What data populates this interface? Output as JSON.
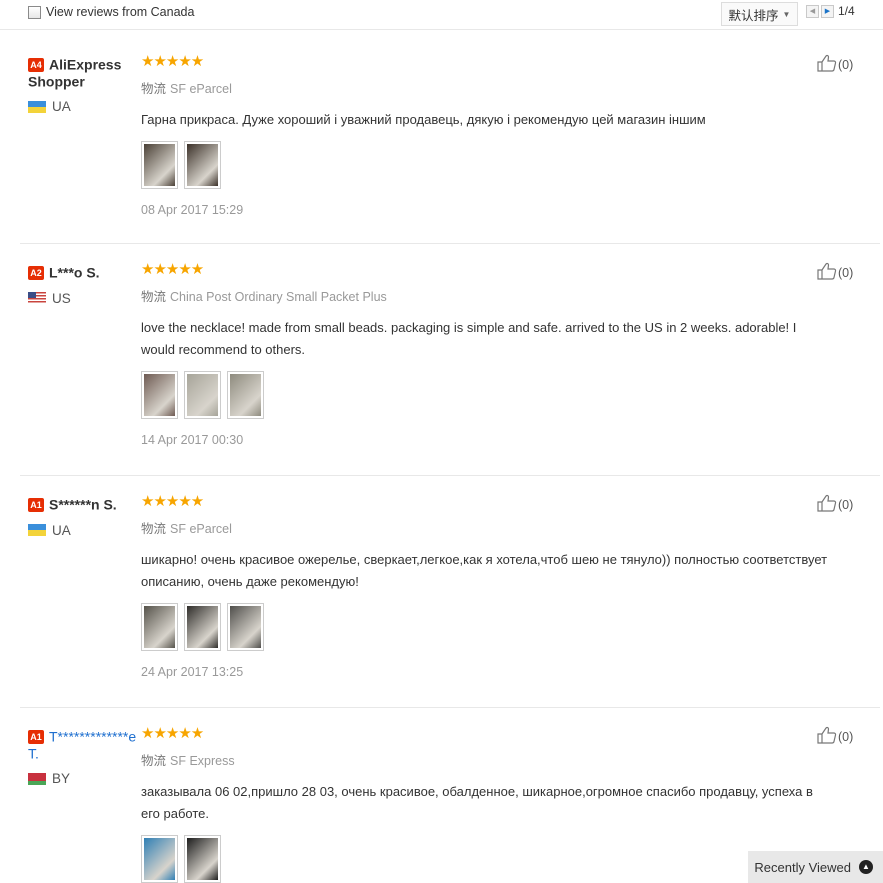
{
  "filter": {
    "canada_label": "View reviews from Canada",
    "canada_checked": false
  },
  "sort": {
    "label": "默认排序"
  },
  "pagination": {
    "count": "1/4"
  },
  "shipping_label": "物流",
  "reviews": [
    {
      "level": "A4",
      "name": "AliExpress Shopper",
      "country": "UA",
      "flag": "UA",
      "stars": "★★★★★",
      "shipping": "SF eParcel",
      "text": "Гарна прикраса. Дуже хороший і уважний продавець, дякую і рекомендую цей магазин іншим",
      "date": "08 Apr 2017 15:29",
      "helpful": "(0)",
      "photos": [
        {
          "color": "#4a4036"
        },
        {
          "color": "#3b3129"
        }
      ]
    },
    {
      "level": "A2",
      "name": "L***o S.",
      "country": "US",
      "flag": "US",
      "stars": "★★★★★",
      "shipping": "China Post Ordinary Small Packet Plus",
      "text": "love the necklace! made from small beads. packaging is simple and safe. arrived to the US in 2 weeks. adorable! I would recommend to others.",
      "date": "14 Apr 2017 00:30",
      "helpful": "(0)",
      "photos": [
        {
          "color": "#6e5a52"
        },
        {
          "color": "#a6a499"
        },
        {
          "color": "#8e8b7e"
        }
      ]
    },
    {
      "level": "A1",
      "name": "S******n S.",
      "country": "UA",
      "flag": "UA",
      "stars": "★★★★★",
      "shipping": "SF eParcel",
      "text": "шикарно! очень красивое ожерелье, сверкает,легкое,как я хотела,чтоб шею не тянуло)) полностью соответствует описанию, очень даже рекомендую!",
      "date": "24 Apr 2017 13:25",
      "helpful": "(0)",
      "photos": [
        {
          "color": "#55524a"
        },
        {
          "color": "#2f2d2a"
        },
        {
          "color": "#4f4e4b"
        }
      ]
    },
    {
      "level": "A1",
      "name": "T*************e T.",
      "country": "BY",
      "flag": "BY",
      "stars": "★★★★★",
      "shipping": "SF Express",
      "text": "заказывала 06 02,пришло 28 03, очень красивое, обалденное, шикарное,огромное спасибо продавцу, успеха в его работе.",
      "date": "",
      "helpful": "(0)",
      "photos": [
        {
          "color": "#2f7fb4"
        },
        {
          "color": "#1d1d1d"
        }
      ]
    }
  ],
  "recently_viewed": {
    "label": "Recently Viewed"
  }
}
